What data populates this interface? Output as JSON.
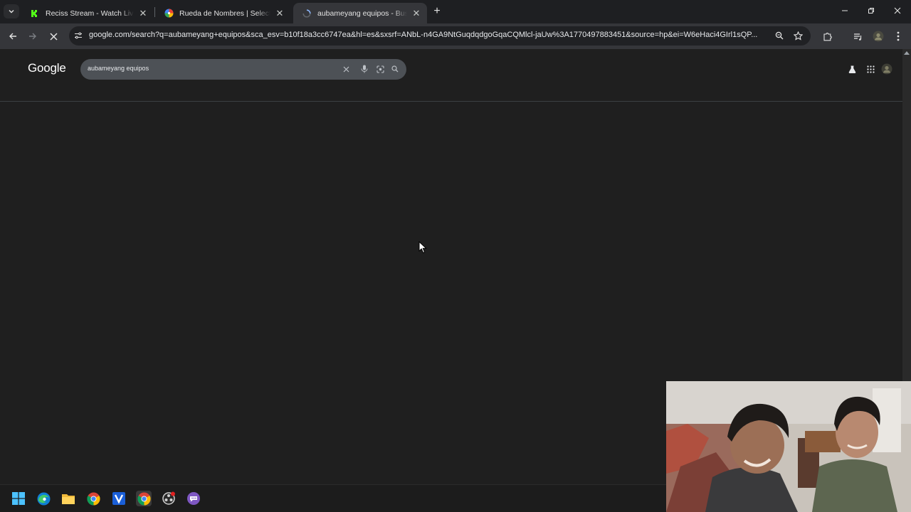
{
  "tabs": [
    {
      "title": "Reciss Stream - Watch Live on Kick",
      "favicon": "kick-logo-icon"
    },
    {
      "title": "Rueda de Nombres | Selector de nombres",
      "favicon": "wheel-icon"
    },
    {
      "title": "aubameyang equipos - Buscar con Google",
      "favicon": "loading-icon",
      "active": true
    }
  ],
  "toolbar": {
    "url": "google.com/search?q=aubameyang+equipos&sca_esv=b10f18a3cc6747ea&hl=es&sxsrf=ANbL-n4GA9NtGuqdqdgoGqaCQMlcl-jaUw%3A1770497883451&source=hp&ei=W6eHaci4GIrl1sQP..."
  },
  "google": {
    "logo_text": "Google",
    "search_value": "aubameyang equipos"
  },
  "colors": {
    "page_bg": "#1f1f1f",
    "searchbox_bg": "#4d5156",
    "tab_active_bg": "#35363a",
    "kick_green": "#53fc18"
  },
  "taskbar": {
    "apps": [
      "windows-start-icon",
      "edge-icon",
      "file-explorer-icon",
      "chrome-icon",
      "v-app-icon",
      "chrome-active-icon",
      "obs-icon",
      "chat-app-icon"
    ]
  }
}
